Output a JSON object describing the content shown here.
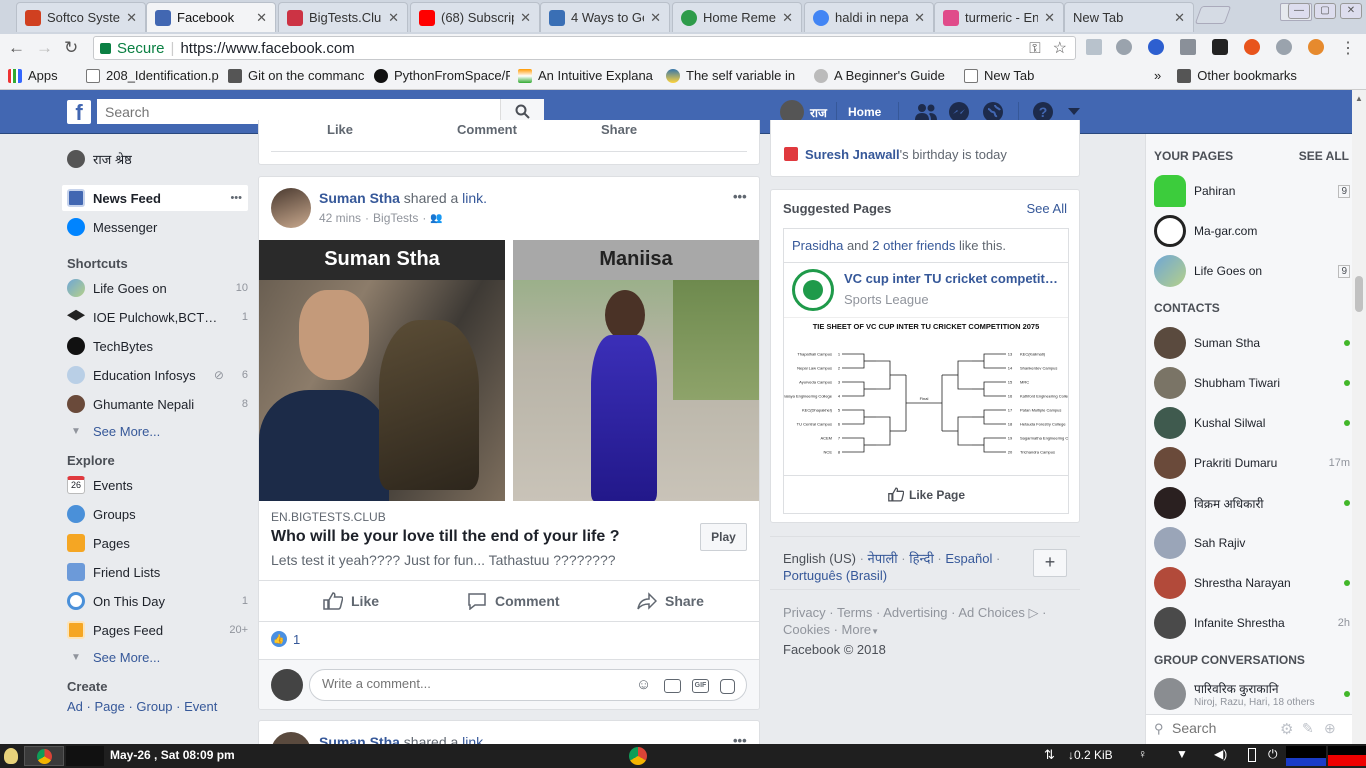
{
  "browser": {
    "tabs": [
      {
        "label": "Softco Syster",
        "color": "#d04020"
      },
      {
        "label": "Facebook",
        "color": "#4267b2"
      },
      {
        "label": "BigTests.Club",
        "color": "#cc3344"
      },
      {
        "label": "(68) Subscrip",
        "color": "#ff0000"
      },
      {
        "label": "4 Ways to Ge",
        "color": "#3a6fb5"
      },
      {
        "label": "Home Remed",
        "color": "#2e9b4a"
      },
      {
        "label": "haldi in nepal",
        "color": "#4285f4"
      },
      {
        "label": "turmeric - En",
        "color": "#e04b8a"
      },
      {
        "label": "New Tab",
        "color": ""
      }
    ],
    "profile": "Raj",
    "address": {
      "secure_label": "Secure",
      "url": "https://www.facebook.com"
    },
    "bookmarks": [
      "Apps",
      "208_Identification.p",
      "Git on the commanc",
      "PythonFromSpace/F",
      "An Intuitive Explana",
      "The self variable in",
      "A Beginner's Guide",
      "New Tab",
      "Other bookmarks"
    ],
    "bookmark_more": "»"
  },
  "fb": {
    "logo": "f",
    "search_placeholder": "Search",
    "user_name": "राज",
    "home": "Home"
  },
  "left_nav": {
    "profile_name": "राज श्रेष्ठ",
    "news_feed": "News Feed",
    "news_feed_more": "•••",
    "messenger": "Messenger",
    "shortcuts_title": "Shortcuts",
    "shortcuts": [
      {
        "label": "Life Goes on",
        "count": "10"
      },
      {
        "label": "IOE Pulchowk,BCT…",
        "count": "1"
      },
      {
        "label": "TechBytes",
        "count": ""
      },
      {
        "label": "Education Infosys",
        "count": "6"
      },
      {
        "label": "Ghumante Nepali",
        "count": "8"
      }
    ],
    "see_more": "See More...",
    "explore_title": "Explore",
    "explore": [
      {
        "label": "Events",
        "count": "",
        "icon_text": "26"
      },
      {
        "label": "Groups",
        "count": "",
        "icon_text": ""
      },
      {
        "label": "Pages",
        "count": "",
        "icon_text": ""
      },
      {
        "label": "Friend Lists",
        "count": "",
        "icon_text": ""
      },
      {
        "label": "On This Day",
        "count": "1",
        "icon_text": ""
      },
      {
        "label": "Pages Feed",
        "count": "20+",
        "icon_text": ""
      }
    ],
    "see_more2": "See More...",
    "create_title": "Create",
    "create_links": [
      "Ad",
      "Page",
      "Group",
      "Event"
    ]
  },
  "prev_post_actions": {
    "like": "Like",
    "comment": "Comment",
    "share": "Share"
  },
  "post": {
    "author": "Suman Stha",
    "shared_text": "shared a",
    "link_word": "link.",
    "time": "42 mins",
    "via": "BigTests",
    "more": "•••",
    "image_left_name": "Suman Stha",
    "image_right_name": "Maniisa",
    "domain": "EN.BIGTESTS.CLUB",
    "title": "Who will be your love till the end of your life ?",
    "description": "Lets test it yeah???? Just for fun... Tathastuu ????????",
    "play": "Play",
    "like": "Like",
    "comment": "Comment",
    "share": "Share",
    "reaction_count": "1",
    "comment_placeholder": "Write a comment..."
  },
  "next_post": {
    "author": "Suman Stha",
    "shared_text": "shared a",
    "link_word": "link."
  },
  "birthday": {
    "name": "Suresh Jnawall",
    "text": "'s birthday is today"
  },
  "suggested": {
    "title": "Suggested Pages",
    "see_all": "See All",
    "friends_like": {
      "name": "Prasidha",
      "and": "and",
      "others": "2 other friends",
      "tail": "like this."
    },
    "page_name": "VC cup inter TU cricket competit…",
    "category": "Sports League",
    "image_title": "TIE SHEET OF VC CUP INTER TU CRICKET COMPETITION 2075",
    "final_label": "Final",
    "left_teams": [
      "Thapathali Campus",
      "Nepal Law Campus",
      "Ayurveda Campus",
      "Himalaya Engineering College",
      "KEC(Dhapakhel)",
      "TU Central Campus",
      "ACEM",
      "NCE"
    ],
    "left_nums": [
      "1",
      "2",
      "3",
      "4",
      "5",
      "6",
      "7",
      "8"
    ],
    "right_teams": [
      "KEC(Kalimati)",
      "Shankerdev Campus",
      "MRC",
      "Kathford Engineering College",
      "Patan Multiple Campus",
      "Hetauda Forestry College",
      "Sagarmatha Engineering College",
      "Trichandra Campus"
    ],
    "right_nums": [
      "13",
      "14",
      "15",
      "16",
      "17",
      "18",
      "19",
      "20"
    ],
    "like_page": "Like Page"
  },
  "languages": {
    "items": [
      "English (US)",
      "नेपाली",
      "हिन्दी",
      "Español",
      "Português (Brasil)"
    ],
    "plus": "+"
  },
  "footer": {
    "links": [
      "Privacy",
      "Terms",
      "Advertising",
      "Ad Choices",
      "Cookies",
      "More"
    ],
    "copyright": "Facebook © 2018"
  },
  "chat": {
    "your_pages": "YOUR PAGES",
    "see_all": "SEE ALL",
    "pages": [
      {
        "name": "Pahiran",
        "count": "9"
      },
      {
        "name": "Ma-gar.com",
        "count": ""
      },
      {
        "name": "Life Goes on",
        "count": "9"
      }
    ],
    "contacts_title": "CONTACTS",
    "contacts": [
      {
        "name": "Suman Stha",
        "status": "online",
        "time": ""
      },
      {
        "name": "Shubham Tiwari",
        "status": "online",
        "time": ""
      },
      {
        "name": "Kushal Silwal",
        "status": "online",
        "time": ""
      },
      {
        "name": "Prakriti Dumaru",
        "status": "away",
        "time": "17m"
      },
      {
        "name": "विक्रम अधिकारी",
        "status": "online",
        "time": ""
      },
      {
        "name": "Sah Rajiv",
        "status": "",
        "time": ""
      },
      {
        "name": "Shrestha Narayan",
        "status": "online",
        "time": ""
      },
      {
        "name": "Infanite Shrestha",
        "status": "away",
        "time": "2h"
      }
    ],
    "group_title": "GROUP CONVERSATIONS",
    "group_name": "पारिवरिक कुराकानि",
    "group_members": "Niroj, Razu, Hari, 18 others",
    "search_placeholder": "Search"
  },
  "taskbar": {
    "datetime": "May-26 , Sat  08:09 pm",
    "net_speed": "↓0.2 KiB"
  }
}
